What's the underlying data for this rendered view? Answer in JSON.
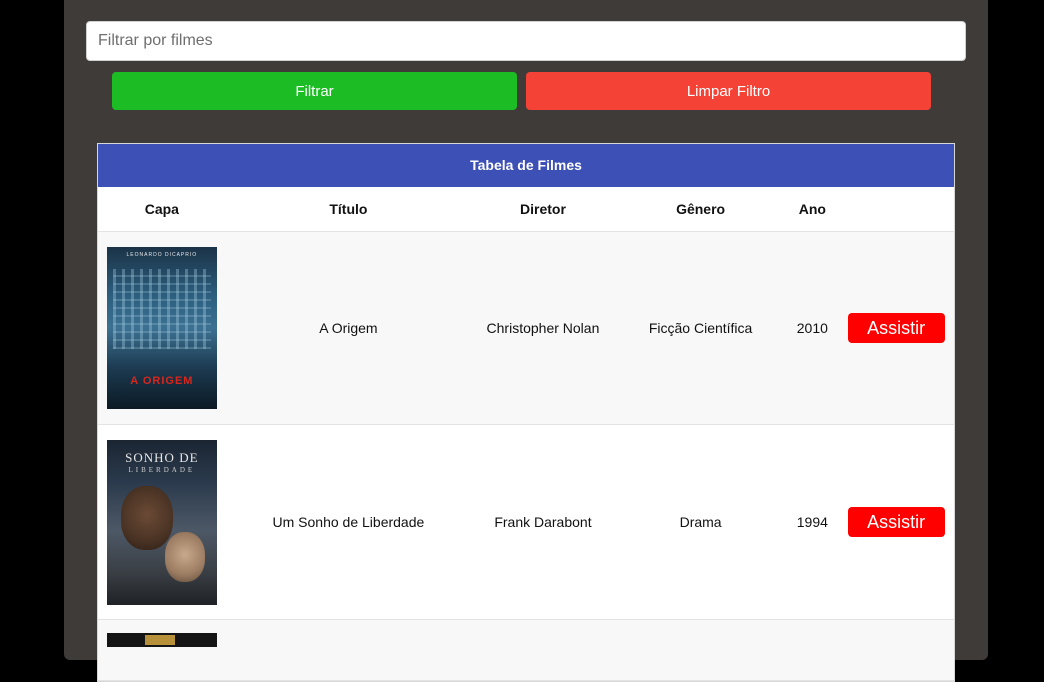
{
  "filter": {
    "placeholder": "Filtrar por filmes",
    "value": "",
    "filter_label": "Filtrar",
    "clear_label": "Limpar Filtro"
  },
  "table": {
    "caption": "Tabela de Filmes",
    "headers": [
      "Capa",
      "Título",
      "Diretor",
      "Gênero",
      "Ano"
    ],
    "rows": [
      {
        "poster_title": "A ORIGEM",
        "poster_top": "LEONARDO DICAPRIO",
        "title": "A Origem",
        "director": "Christopher Nolan",
        "genre": "Ficção Científica",
        "year": "2010",
        "action": "Assistir"
      },
      {
        "poster_title": "SONHO DE",
        "poster_sub": "LIBERDADE",
        "title": "Um Sonho de Liberdade",
        "director": "Frank Darabont",
        "genre": "Drama",
        "year": "1994",
        "action": "Assistir"
      }
    ]
  },
  "colors": {
    "panel": "#3f3b39",
    "filter_button": "#1cbd24",
    "clear_button": "#f44336",
    "caption_bg": "#3d50b5",
    "watch_button": "#ff0000"
  }
}
